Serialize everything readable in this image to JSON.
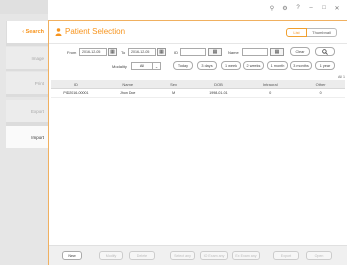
{
  "sidebar": {
    "items": [
      {
        "label": "‹ Search",
        "active": true
      },
      {
        "label": "Image",
        "active": false
      },
      {
        "label": "Print",
        "active": false
      },
      {
        "label": "Export",
        "active": false
      },
      {
        "label": "Import",
        "active": false
      }
    ]
  },
  "window_controls": {
    "pin": "⚲",
    "settings": "⚙",
    "help": "?",
    "minimize": "–",
    "maximize": "□",
    "close": "✕"
  },
  "header": {
    "title": "Patient Selection",
    "view_toggle": {
      "list": "List",
      "thumbnail": "Thumbnail"
    }
  },
  "filters": {
    "from_label": "From",
    "from_value": "2016-12-05",
    "to_label": "To",
    "to_value": "2016-12-05",
    "id_label": "ID",
    "id_value": "",
    "name_label": "Name",
    "name_value": "",
    "clear_label": "Clear",
    "modality_label": "Modality",
    "modality_value": "All",
    "ranges": [
      "Today",
      "3 days",
      "1 week",
      "2 weeks",
      "1 month",
      "3 months",
      "1 year"
    ]
  },
  "table": {
    "count": "All 1",
    "columns": [
      "ID",
      "Name",
      "Sex",
      "DOB",
      "Intraoral",
      "Other"
    ],
    "rows": [
      {
        "id": "PID2016-00001",
        "name": "Jhon Doe",
        "sex": "M",
        "dob": "1998-01-01",
        "intraoral": "0",
        "other": "0"
      }
    ]
  },
  "bottom_bar": {
    "buttons": [
      {
        "label": "New",
        "enabled": true
      },
      {
        "label": "Modify",
        "enabled": false
      },
      {
        "label": "Delete",
        "enabled": false
      },
      {
        "label": "Select any",
        "enabled": false
      },
      {
        "label": "IO Exam any",
        "enabled": false
      },
      {
        "label": "Ex Exam any",
        "enabled": false
      },
      {
        "label": "Export",
        "enabled": false
      },
      {
        "label": "Open",
        "enabled": false
      }
    ]
  }
}
